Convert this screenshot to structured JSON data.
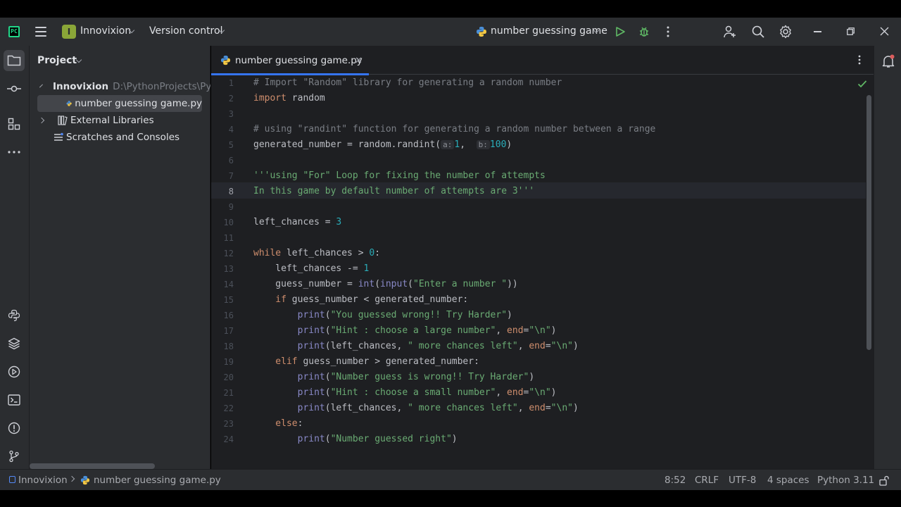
{
  "titlebar": {
    "project_badge": "I",
    "project_name": "Innovixion",
    "vcs_label": "Version control",
    "run_config": "number guessing game"
  },
  "project_panel": {
    "title": "Project",
    "tree": [
      {
        "label": "Innovixion",
        "hint": "D:\\PythonProjects\\Py",
        "kind": "folder",
        "expanded": true
      },
      {
        "label": "number guessing game.py",
        "kind": "python-file",
        "selected": true
      },
      {
        "label": "External Libraries",
        "kind": "library",
        "expanded": false
      },
      {
        "label": "Scratches and Consoles",
        "kind": "scratches"
      }
    ]
  },
  "editor": {
    "tab_label": "number guessing game.py",
    "current_line": 8,
    "line_numbers": [
      "1",
      "2",
      "3",
      "4",
      "5",
      "6",
      "7",
      "8",
      "9",
      "10",
      "11",
      "12",
      "13",
      "14",
      "15",
      "16",
      "17",
      "18",
      "19",
      "20",
      "21",
      "22",
      "23",
      "24"
    ],
    "code": {
      "l1": "# Import \"Random\" library for generating a random number",
      "l2_kw": "import",
      "l2_rest": " random",
      "l4": "# using \"randint\" function for generating a random number between a range",
      "l5_a": "generated_number = random.randint(",
      "l5_hint_a": "a:",
      "l5_val_a": "1",
      "l5_comma": ",  ",
      "l5_hint_b": "b:",
      "l5_val_b": "100",
      "l5_end": ")",
      "l7": "'''using \"For\" Loop for fixing the number of attempts",
      "l8": "In this game by default number of attempts are 3'''",
      "l10_a": "left_chances = ",
      "l10_num": "3",
      "l12_kw": "while",
      "l12_mid": " left_chances > ",
      "l12_num": "0",
      "l12_end": ":",
      "l13_a": "    left_chances -= ",
      "l13_num": "1",
      "l14_a": "    guess_number = ",
      "l14_fn1": "int",
      "l14_p1": "(",
      "l14_fn2": "input",
      "l14_p2": "(",
      "l14_str": "\"Enter a number \"",
      "l14_end": "))",
      "l15_kw": "    if",
      "l15_rest": " guess_number < generated_number:",
      "l16_fn": "        print",
      "l16_p": "(",
      "l16_str": "\"You guessed wrong!! Try Harder\"",
      "l16_end": ")",
      "l17_fn": "        print",
      "l17_p": "(",
      "l17_str": "\"Hint : choose a large number\"",
      "l17_comma": ", ",
      "l17_kw": "end",
      "l17_eq": "=",
      "l17_str2": "\"\\n\"",
      "l17_end": ")",
      "l18_fn": "        print",
      "l18_p": "(left_chances, ",
      "l18_str": "\" more chances left\"",
      "l18_comma": ", ",
      "l18_kw": "end",
      "l18_eq": "=",
      "l18_str2": "\"\\n\"",
      "l18_end": ")",
      "l19_kw": "    elif",
      "l19_rest": " guess_number > generated_number:",
      "l20_fn": "        print",
      "l20_p": "(",
      "l20_str": "\"Number guess is wrong!! Try Harder\"",
      "l20_end": ")",
      "l21_fn": "        print",
      "l21_p": "(",
      "l21_str": "\"Hint : choose a small number\"",
      "l21_comma": ", ",
      "l21_kw": "end",
      "l21_eq": "=",
      "l21_str2": "\"\\n\"",
      "l21_end": ")",
      "l22_fn": "        print",
      "l22_p": "(left_chances, ",
      "l22_str": "\" more chances left\"",
      "l22_comma": ", ",
      "l22_kw": "end",
      "l22_eq": "=",
      "l22_str2": "\"\\n\"",
      "l22_end": ")",
      "l23_kw": "    else",
      "l23_end": ":",
      "l24_fn": "        print",
      "l24_p": "(",
      "l24_str": "\"Number guessed right\"",
      "l24_end": ")"
    }
  },
  "statusbar": {
    "breadcrumb_project": "Innovixion",
    "breadcrumb_file": "number guessing game.py",
    "position": "8:52",
    "line_sep": "CRLF",
    "encoding": "UTF-8",
    "indent": "4 spaces",
    "interpreter": "Python 3.11"
  },
  "colors": {
    "accent": "#3574f0",
    "keyword": "#cf8e6d",
    "string": "#6aab73",
    "number": "#2aacb8",
    "comment": "#7a7e85",
    "run_green": "#5fb865"
  }
}
